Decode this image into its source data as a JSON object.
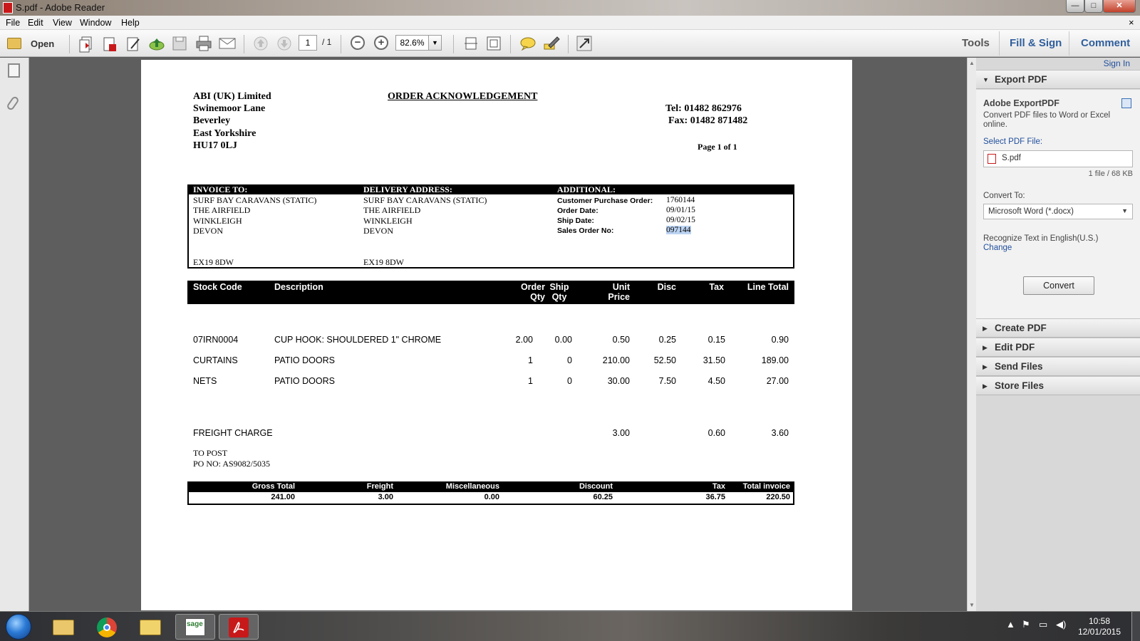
{
  "window": {
    "title": "S.pdf - Adobe Reader",
    "min_label": "—",
    "max_label": "□",
    "close_label": "✕",
    "doc_close": "×"
  },
  "menu": {
    "file": "File",
    "edit": "Edit",
    "view": "View",
    "window": "Window",
    "help": "Help"
  },
  "toolbar": {
    "open_label": "Open",
    "page_current": "1",
    "page_total": "/ 1",
    "zoom": "82.6%",
    "zoom_arrow": "▼",
    "zoom_out": "−",
    "zoom_in": "+",
    "tools_label": "Tools",
    "fill_sign_label": "Fill & Sign",
    "comment_label": "Comment"
  },
  "icons": {
    "open": "folder-icon",
    "create": "create-pdf-icon",
    "edit": "edit-pdf-icon",
    "sign": "sign-icon",
    "upload": "upload-icon",
    "save": "save-icon",
    "print": "print-icon",
    "mail": "mail-icon",
    "prev": "page-up-icon",
    "next": "page-down-icon",
    "fit_page": "fit-page-icon",
    "fit_width": "fit-width-icon",
    "comment": "sticky-note-icon",
    "highlight": "highlight-icon",
    "fullscreen": "fullscreen-icon"
  },
  "document": {
    "company_lines": [
      "ABI (UK) Limited",
      "Swinemoor Lane",
      "Beverley",
      "East Yorkshire",
      "HU17 0LJ"
    ],
    "doc_title": "ORDER ACKNOWLEDGEMENT",
    "tel": "Tel:   01482 862976",
    "fax": "Fax: 01482 871482",
    "page_label": "Page 1 of 1",
    "invoice_to_head": "INVOICE TO:",
    "invoice_to": [
      "SURF BAY CARAVANS (STATIC)",
      "THE AIRFIELD",
      "WINKLEIGH",
      "DEVON",
      "EX19 8DW"
    ],
    "delivery_head": "DELIVERY ADDRESS:",
    "delivery": [
      "SURF BAY CARAVANS (STATIC)",
      "THE AIRFIELD",
      "WINKLEIGH",
      "DEVON",
      "EX19 8DW"
    ],
    "additional_head": "ADDITIONAL:",
    "additional": [
      {
        "label": "Customer Purchase Order:",
        "value": "1760144"
      },
      {
        "label": "Order Date:",
        "value": "09/01/15"
      },
      {
        "label": "Ship Date:",
        "value": "09/02/15"
      },
      {
        "label": "Sales Order No:",
        "value": "097144"
      }
    ],
    "columns": {
      "stock_code": "Stock Code",
      "description": "Description",
      "order_qty_1": "Order",
      "order_qty_2": "Qty",
      "ship_qty_1": "Ship",
      "ship_qty_2": "Qty",
      "unit_price_1": "Unit",
      "unit_price_2": "Price",
      "disc": "Disc",
      "tax": "Tax",
      "line_total": "Line Total"
    },
    "lines": [
      {
        "code": "07IRN0004",
        "desc": "CUP HOOK: SHOULDERED 1\" CHROME",
        "oqty": "2.00",
        "sqty": "0.00",
        "price": "0.50",
        "disc": "0.25",
        "tax": "0.15",
        "total": "0.90"
      },
      {
        "code": "CURTAINS",
        "desc": "PATIO DOORS",
        "oqty": "1",
        "sqty": "0",
        "price": "210.00",
        "disc": "52.50",
        "tax": "31.50",
        "total": "189.00"
      },
      {
        "code": "NETS",
        "desc": "PATIO DOORS",
        "oqty": "1",
        "sqty": "0",
        "price": "30.00",
        "disc": "7.50",
        "tax": "4.50",
        "total": "27.00"
      }
    ],
    "freight": {
      "label": "FREIGHT CHARGE",
      "price": "3.00",
      "tax": "0.60",
      "total": "3.60"
    },
    "notes": [
      "TO POST",
      "PO NO: AS9082/5035"
    ],
    "totals_heads": [
      "Gross Total",
      "Freight",
      "Miscellaneous",
      "Discount",
      "Tax",
      "Total invoice"
    ],
    "totals_values": [
      "241.00",
      "3.00",
      "0.00",
      "60.25",
      "36.75",
      "220.50"
    ]
  },
  "panel": {
    "sign_in": "Sign In",
    "export_head": "Export PDF",
    "export_title": "Adobe ExportPDF",
    "export_desc": "Convert PDF files to Word or Excel online.",
    "select_label": "Select PDF File:",
    "file_name": "S.pdf",
    "file_info": "1 file / 68 KB",
    "convert_to_label": "Convert To:",
    "convert_format": "Microsoft Word (*.docx)",
    "recognize": "Recognize Text in English(U.S.)",
    "change_link": "Change",
    "convert_button": "Convert",
    "sections": [
      "Create PDF",
      "Edit PDF",
      "Send Files",
      "Store Files"
    ]
  },
  "taskbar": {
    "time": "10:58",
    "date": "12/01/2015",
    "apps": [
      "file-explorer-icon",
      "chrome-icon",
      "outlook-icon",
      "sage-icon",
      "adobe-reader-icon"
    ],
    "sage_label": "sage"
  },
  "colors": {
    "accent": "#2f5e9c",
    "reader_red": "#c8191a",
    "highlight": "#bcd4f3"
  }
}
